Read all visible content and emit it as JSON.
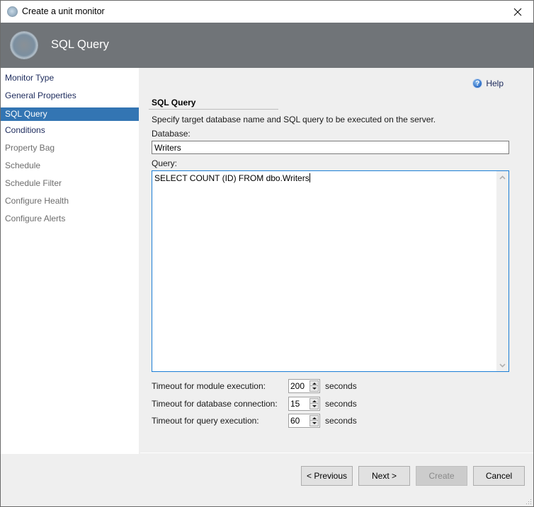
{
  "window": {
    "title": "Create a unit monitor",
    "close_icon": "close-icon"
  },
  "header": {
    "title": "SQL Query",
    "icon": "wizard-orb-icon"
  },
  "sidebar": {
    "items": [
      {
        "label": "Monitor Type",
        "state": "enabled"
      },
      {
        "label": "General Properties",
        "state": "enabled"
      },
      {
        "label": "SQL Query",
        "state": "selected"
      },
      {
        "label": "Conditions",
        "state": "enabled"
      },
      {
        "label": "Property Bag",
        "state": "disabled"
      },
      {
        "label": "Schedule",
        "state": "disabled"
      },
      {
        "label": "Schedule Filter",
        "state": "disabled"
      },
      {
        "label": "Configure Health",
        "state": "disabled"
      },
      {
        "label": "Configure Alerts",
        "state": "disabled"
      }
    ]
  },
  "main": {
    "help_label": "Help",
    "section_title": "SQL Query",
    "description": "Specify target database name and SQL query to be executed on the server.",
    "database_label": "Database:",
    "database_value": "Writers",
    "query_label": "Query:",
    "query_value": "SELECT COUNT (ID) FROM dbo.Writers",
    "timeouts": [
      {
        "label": "Timeout for module execution:",
        "value": "200",
        "units": "seconds"
      },
      {
        "label": "Timeout for database connection:",
        "value": "15",
        "units": "seconds"
      },
      {
        "label": "Timeout for query execution:",
        "value": "60",
        "units": "seconds"
      }
    ]
  },
  "footer": {
    "previous_label": "< Previous",
    "next_label": "Next >",
    "create_label": "Create",
    "cancel_label": "Cancel"
  },
  "colors": {
    "header_bg": "#707478",
    "selected_item_bg": "#3375b3",
    "enabled_item_text": "#1c2a5c",
    "disabled_item_text": "#6d6d6d",
    "focus_border": "#1b7ed6"
  }
}
